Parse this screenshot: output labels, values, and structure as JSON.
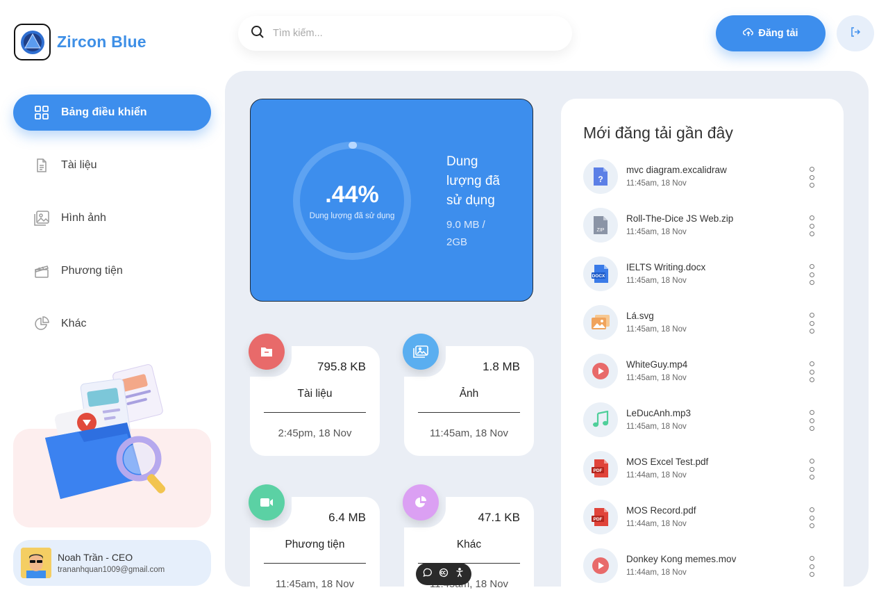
{
  "app": {
    "name": "Zircon Blue"
  },
  "search": {
    "placeholder": "Tìm kiếm..."
  },
  "header": {
    "upload_label": "Đăng tải"
  },
  "sidebar": {
    "items": [
      {
        "label": "Bảng điều khiển",
        "icon": "grid-icon",
        "active": true
      },
      {
        "label": "Tài liệu",
        "icon": "document-icon"
      },
      {
        "label": "Hình ảnh",
        "icon": "image-icon"
      },
      {
        "label": "Phương tiện",
        "icon": "clapperboard-icon"
      },
      {
        "label": "Khác",
        "icon": "pie-chart-icon"
      }
    ]
  },
  "user": {
    "name": "Noah Trần - CEO",
    "email": "trananhquan1009@gmail.com"
  },
  "storage": {
    "percent_label": ".44%",
    "percent_value": 0.44,
    "subtitle": "Dung lượng đã sử dụng",
    "title": "Dung lượng đã sử dụng",
    "used_text": "9.0 MB / 2GB"
  },
  "categories": [
    {
      "label": "Tài liệu",
      "size": "795.8 KB",
      "time": "2:45pm, 18 Nov",
      "color": "#e86a6a",
      "icon": "folder-icon"
    },
    {
      "label": "Ảnh",
      "size": "1.8 MB",
      "time": "11:45am, 18 Nov",
      "color": "#5aaef0",
      "icon": "image-icon"
    },
    {
      "label": "Phương tiện",
      "size": "6.4 MB",
      "time": "11:45am, 18 Nov",
      "color": "#5bd1a4",
      "icon": "video-icon"
    },
    {
      "label": "Khác",
      "size": "47.1 KB",
      "time": "11:45am, 18 Nov",
      "color": "#dba0f3",
      "icon": "pie-chart-icon"
    }
  ],
  "recent": {
    "title": "Mới đăng tải gần đây",
    "files": [
      {
        "name": "mvc diagram.excalidraw",
        "date": "11:45am, 18 Nov",
        "icon": "unknown-file-icon"
      },
      {
        "name": "Roll-The-Dice JS Web.zip",
        "date": "11:45am, 18 Nov",
        "icon": "zip-file-icon"
      },
      {
        "name": "IELTS Writing.docx",
        "date": "11:45am, 18 Nov",
        "icon": "docx-file-icon"
      },
      {
        "name": "Lá.svg",
        "date": "11:45am, 18 Nov",
        "icon": "image-file-icon"
      },
      {
        "name": "WhiteGuy.mp4",
        "date": "11:45am, 18 Nov",
        "icon": "video-file-icon"
      },
      {
        "name": "LeDucAnh.mp3",
        "date": "11:45am, 18 Nov",
        "icon": "audio-file-icon"
      },
      {
        "name": "MOS Excel Test.pdf",
        "date": "11:44am, 18 Nov",
        "icon": "pdf-file-icon"
      },
      {
        "name": "MOS Record.pdf",
        "date": "11:44am, 18 Nov",
        "icon": "pdf-file-icon"
      },
      {
        "name": "Donkey Kong memes.mov",
        "date": "11:44am, 18 Nov",
        "icon": "video-file-icon"
      }
    ]
  },
  "colors": {
    "accent": "#3d8eed",
    "panel": "#eaeef5"
  }
}
